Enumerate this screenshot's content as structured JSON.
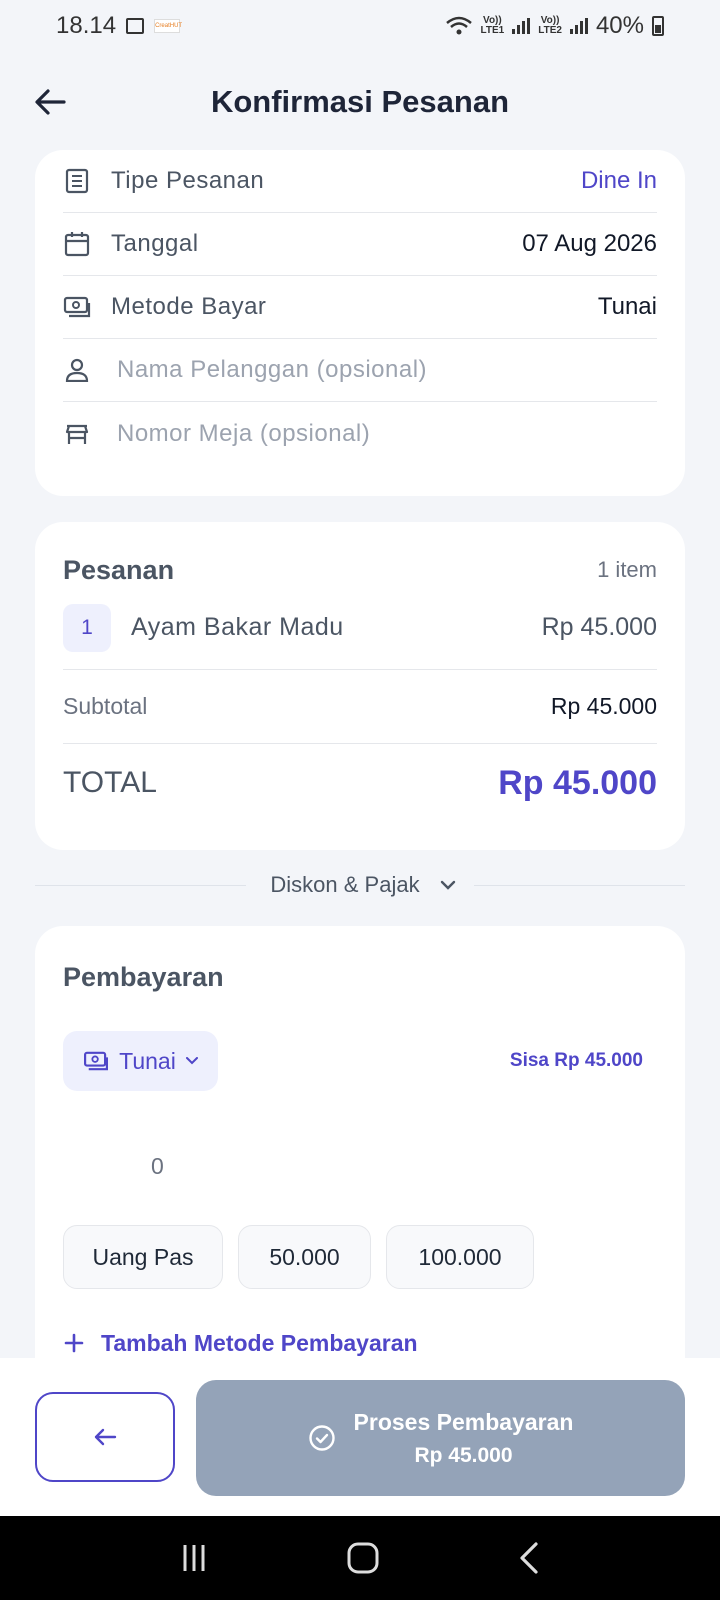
{
  "status_bar": {
    "time": "18.14",
    "battery": "40%",
    "lte1": "LTE1",
    "lte2": "LTE2",
    "volte": "Vo))",
    "logo_text": "CreatHUT"
  },
  "header": {
    "title": "Konfirmasi Pesanan"
  },
  "order_info": {
    "type_label": "Tipe Pesanan",
    "type_value": "Dine In",
    "date_label": "Tanggal",
    "date_value": "07 Aug 2026",
    "method_label": "Metode Bayar",
    "method_value": "Tunai",
    "customer_placeholder": "Nama Pelanggan (opsional)",
    "table_placeholder": "Nomor Meja (opsional)"
  },
  "order": {
    "title": "Pesanan",
    "count": "1 item",
    "items": [
      {
        "qty": "1",
        "name": "Ayam Bakar Madu",
        "price": "Rp 45.000"
      }
    ],
    "subtotal_label": "Subtotal",
    "subtotal_value": "Rp 45.000",
    "total_label": "TOTAL",
    "total_value": "Rp 45.000"
  },
  "discount_toggle": {
    "label": "Diskon & Pajak"
  },
  "payment": {
    "title": "Pembayaran",
    "method": "Tunai",
    "remaining": "Sisa Rp 45.000",
    "amount": "0",
    "quick": [
      "Uang Pas",
      "50.000",
      "100.000"
    ],
    "add_method": "Tambah Metode Pembayaran"
  },
  "bottom": {
    "process_label": "Proses Pembayaran",
    "process_amount": "Rp 45.000"
  },
  "colors": {
    "accent": "#4f46c8",
    "disabled_button": "#94a3b8",
    "background": "#f3f5f9"
  }
}
